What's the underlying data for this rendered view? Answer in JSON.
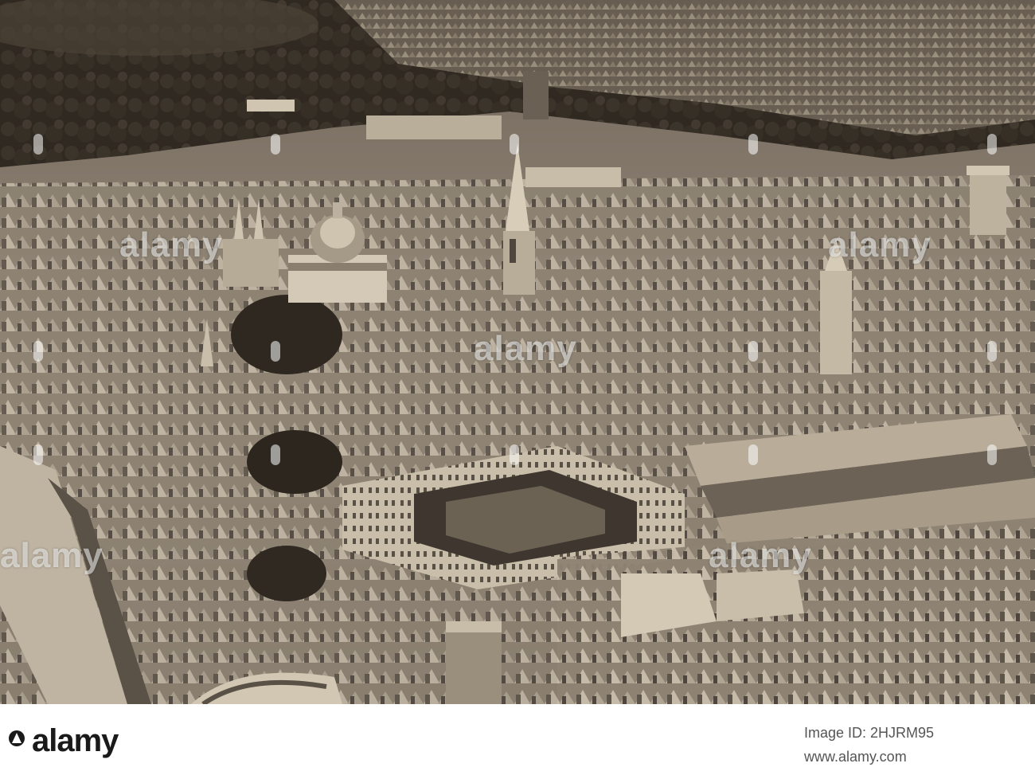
{
  "watermark": {
    "word": "alamy",
    "color": "#ffffff"
  },
  "photo": {
    "tone": "sepia",
    "colors": {
      "sky_dark": "#2b241d",
      "trees": "#3a332a",
      "stone_light": "#cfc4b3",
      "stone_mid": "#9b8f7f",
      "shadow": "#4a4238"
    }
  },
  "footer": {
    "brand": "alamy",
    "image_id_label": "Image ID: 2HJRM95",
    "image_id": "",
    "url": "www.alamy.com"
  }
}
